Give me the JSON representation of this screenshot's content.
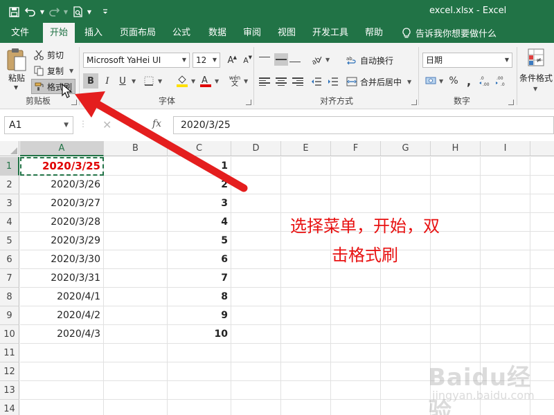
{
  "window": {
    "title": "excel.xlsx  -  Excel"
  },
  "tabs": [
    {
      "label": "文件"
    },
    {
      "label": "开始"
    },
    {
      "label": "插入"
    },
    {
      "label": "页面布局"
    },
    {
      "label": "公式"
    },
    {
      "label": "数据"
    },
    {
      "label": "审阅"
    },
    {
      "label": "视图"
    },
    {
      "label": "开发工具"
    },
    {
      "label": "帮助"
    }
  ],
  "tell_me": "告诉我你想要做什么",
  "ribbon": {
    "clipboard": {
      "paste": "粘贴",
      "cut": "剪切",
      "copy": "复制",
      "format_painter": "格式刷",
      "label": "剪贴板"
    },
    "font": {
      "name": "Microsoft YaHei UI",
      "size": "12",
      "grow": "A",
      "shrink": "A",
      "bold": "B",
      "italic": "I",
      "underline": "U",
      "phonetic_top": "wén",
      "phonetic_bottom": "文",
      "label": "字体"
    },
    "alignment": {
      "wrap": "自动换行",
      "merge": "合并后居中",
      "label": "对齐方式"
    },
    "number": {
      "format": "日期",
      "percent": "%",
      "comma": ",",
      "label": "数字"
    },
    "styles": {
      "conditional": "条件格式"
    }
  },
  "formula_bar": {
    "name_box": "A1",
    "fx": "fx",
    "formula": "2020/3/25"
  },
  "columns": [
    "A",
    "B",
    "C",
    "D",
    "E",
    "F",
    "G",
    "H",
    "I"
  ],
  "rows": [
    {
      "num": "1",
      "a": "2020/3/25",
      "c": "1"
    },
    {
      "num": "2",
      "a": "2020/3/26",
      "c": "2"
    },
    {
      "num": "3",
      "a": "2020/3/27",
      "c": "3"
    },
    {
      "num": "4",
      "a": "2020/3/28",
      "c": "4"
    },
    {
      "num": "5",
      "a": "2020/3/29",
      "c": "5"
    },
    {
      "num": "6",
      "a": "2020/3/30",
      "c": "6"
    },
    {
      "num": "7",
      "a": "2020/3/31",
      "c": "7"
    },
    {
      "num": "8",
      "a": "2020/4/1",
      "c": "8"
    },
    {
      "num": "9",
      "a": "2020/4/2",
      "c": "9"
    },
    {
      "num": "10",
      "a": "2020/4/3",
      "c": "10"
    },
    {
      "num": "11",
      "a": "",
      "c": ""
    },
    {
      "num": "12",
      "a": "",
      "c": ""
    },
    {
      "num": "13",
      "a": "",
      "c": ""
    },
    {
      "num": "14",
      "a": "",
      "c": ""
    }
  ],
  "annotation": {
    "line1": "选择菜单，开始，双",
    "line2": "击格式刷"
  },
  "watermark": {
    "text": "Baidu经验",
    "sub": "jingyan.baidu.com"
  },
  "colors": {
    "excel_green": "#217346",
    "annotation_red": "#e81010",
    "cell_red": "#e00000"
  }
}
